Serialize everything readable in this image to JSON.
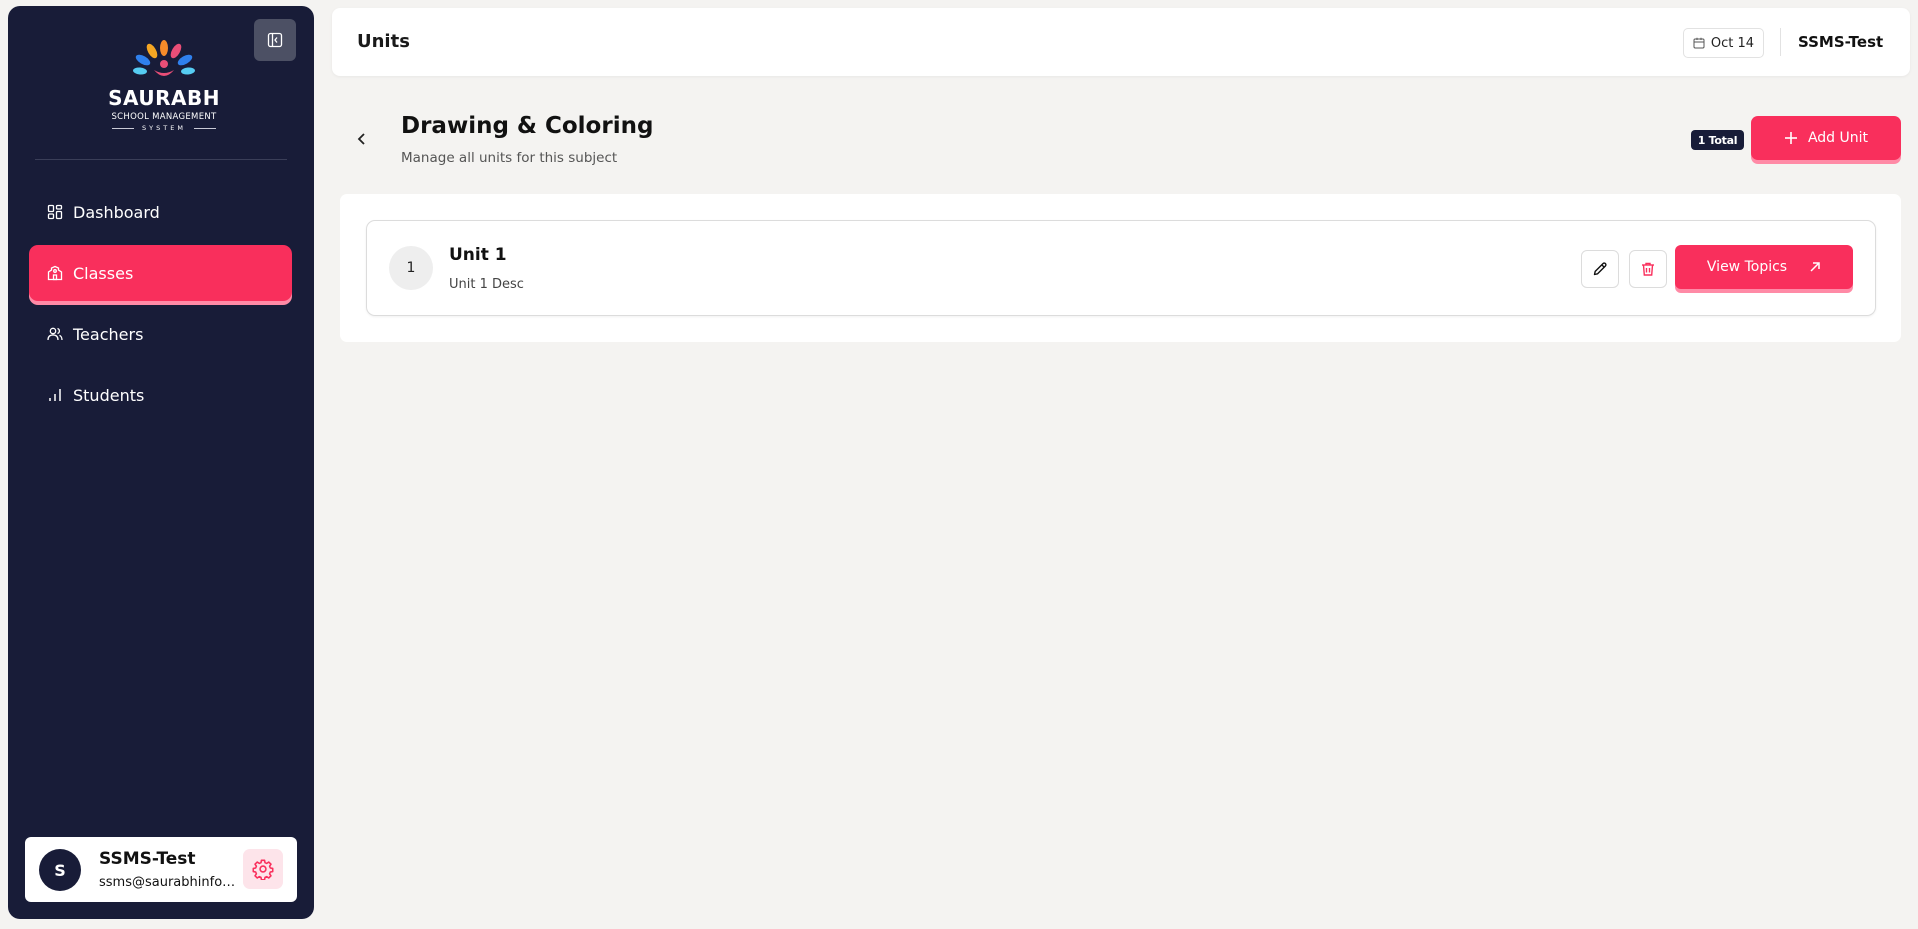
{
  "sidebar": {
    "logo": {
      "name": "SAURABH",
      "tagline": "SCHOOL MANAGEMENT",
      "tagline2": "SYSTEM"
    },
    "items": [
      {
        "label": "Dashboard",
        "icon": "dashboard-grid-icon",
        "active": false
      },
      {
        "label": "Classes",
        "icon": "school-building-icon",
        "active": true
      },
      {
        "label": "Teachers",
        "icon": "users-icon",
        "active": false
      },
      {
        "label": "Students",
        "icon": "bar-chart-icon",
        "active": false
      }
    ],
    "user": {
      "initial": "S",
      "name": "SSMS-Test",
      "email": "ssms@saurabhinfosys.com"
    }
  },
  "header": {
    "title": "Units",
    "date": "Oct 14",
    "user": "SSMS-Test"
  },
  "page": {
    "title": "Drawing & Coloring",
    "subtitle": "Manage all units for this subject",
    "total_badge": "1 Total",
    "add_button": "Add Unit"
  },
  "units": [
    {
      "number": "1",
      "title": "Unit 1",
      "description": "Unit 1 Desc",
      "view_button": "View Topics"
    }
  ],
  "colors": {
    "sidebar_bg": "#181c38",
    "accent": "#f92f5c",
    "accent_shadow": "#ff8aa6",
    "page_bg": "#f4f3f1"
  }
}
